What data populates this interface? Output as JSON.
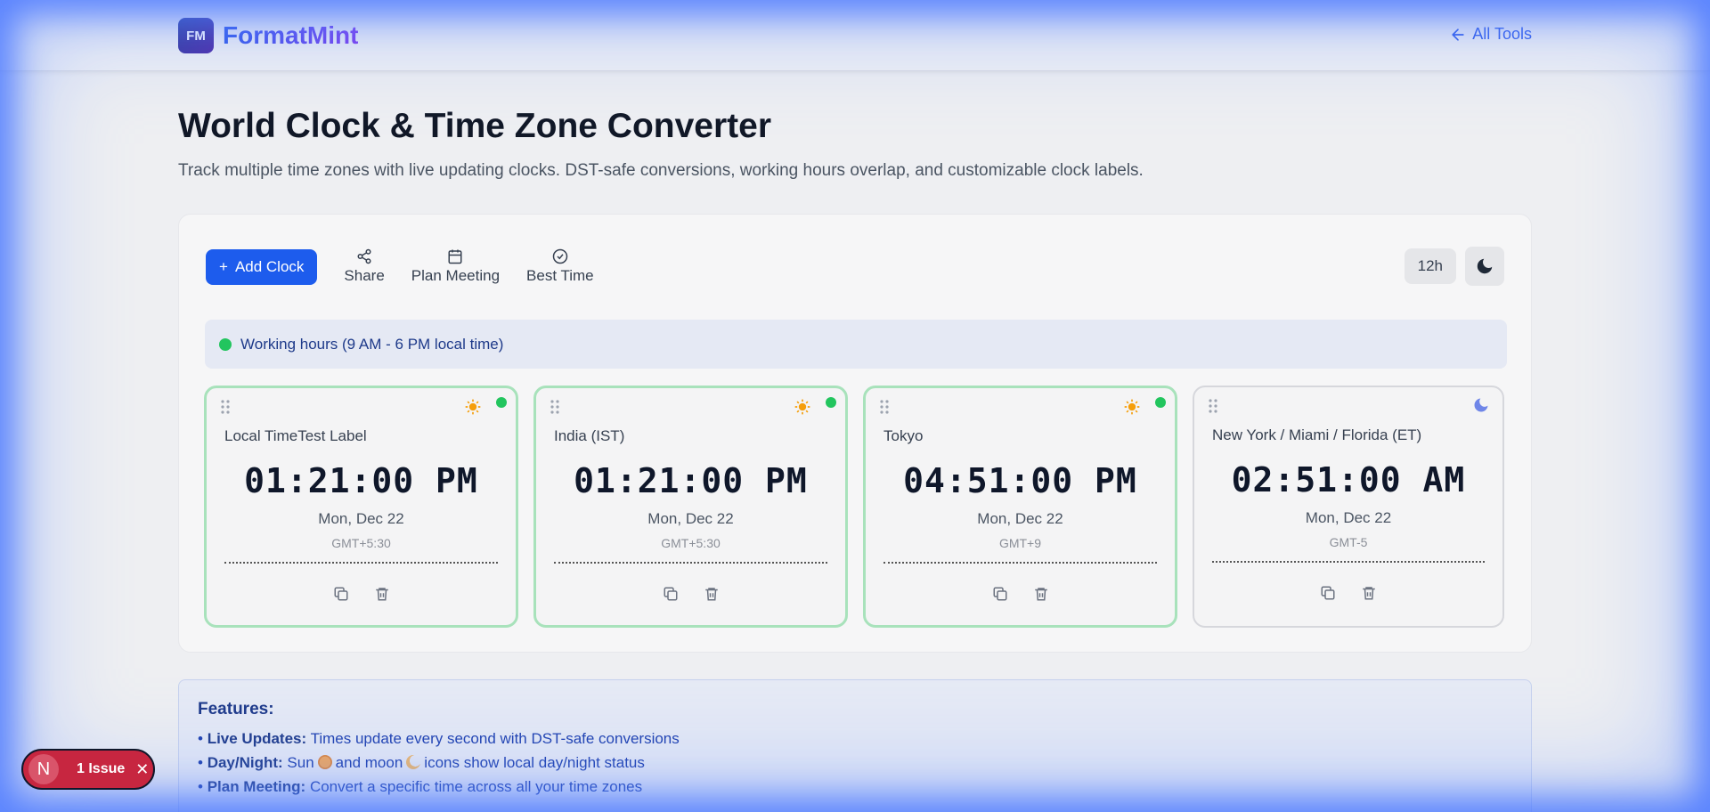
{
  "header": {
    "logo_mark": "FM",
    "logo_text": "FormatMint",
    "all_tools": "All Tools"
  },
  "page": {
    "title": "World Clock & Time Zone Converter",
    "subtitle": "Track multiple time zones with live updating clocks. DST-safe conversions, working hours overlap, and customizable clock labels."
  },
  "toolbar": {
    "add_clock": "Add Clock",
    "add_icon": "+",
    "share": "Share",
    "plan_meeting": "Plan Meeting",
    "best_time": "Best Time",
    "format": "12h"
  },
  "legend": {
    "text": "Working hours (9 AM - 6 PM local time)"
  },
  "clocks": [
    {
      "label": "Local TimeTest Label",
      "time": "01:21:00 PM",
      "date": "Mon, Dec 22",
      "gmt": "GMT+5:30",
      "daytime": true
    },
    {
      "label": "India (IST)",
      "time": "01:21:00 PM",
      "date": "Mon, Dec 22",
      "gmt": "GMT+5:30",
      "daytime": true
    },
    {
      "label": "Tokyo",
      "time": "04:51:00 PM",
      "date": "Mon, Dec 22",
      "gmt": "GMT+9",
      "daytime": true
    },
    {
      "label": "New York / Miami / Florida (ET)",
      "time": "02:51:00 AM",
      "date": "Mon, Dec 22",
      "gmt": "GMT-5",
      "daytime": false
    }
  ],
  "features": {
    "heading": "Features:",
    "items": [
      {
        "title": "Live Updates:",
        "text": "Times update every second with DST-safe conversions"
      },
      {
        "title": "Day/Night:",
        "text_a": "Sun",
        "text_b": "and moon",
        "text_c": "icons show local day/night status"
      },
      {
        "title": "Plan Meeting:",
        "text": "Convert a specific time across all your time zones"
      }
    ]
  },
  "issue": {
    "letter": "N",
    "text": "1 Issue",
    "close": "✕"
  },
  "colors": {
    "accent": "#1d5ced",
    "working": "#22c55e",
    "border_day": "#a8e2bb",
    "issue": "#c72640"
  }
}
